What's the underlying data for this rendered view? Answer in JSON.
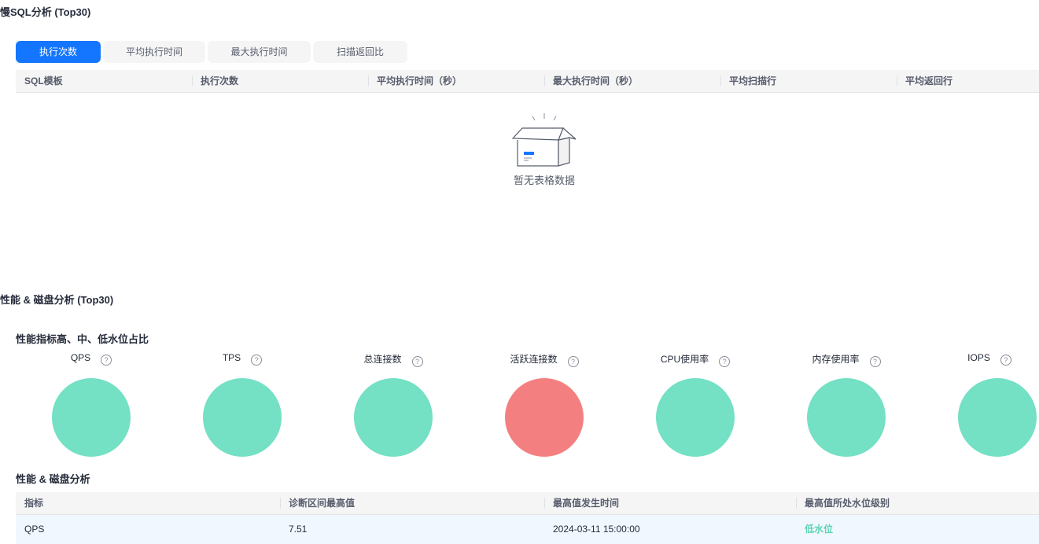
{
  "slow_sql": {
    "title": "慢SQL分析 (Top30)",
    "tabs": [
      {
        "label": "执行次数",
        "active": true
      },
      {
        "label": "平均执行时间",
        "active": false
      },
      {
        "label": "最大执行时间",
        "active": false
      },
      {
        "label": "扫描返回比",
        "active": false
      }
    ],
    "columns": [
      "SQL模板",
      "执行次数",
      "平均执行时间（秒）",
      "最大执行时间（秒）",
      "平均扫描行",
      "平均返回行"
    ],
    "empty_text": "暂无表格数据"
  },
  "performance": {
    "title": "性能 & 磁盘分析 (Top30)",
    "ratio_title": "性能指标高、中、低水位占比",
    "help_glyph": "?",
    "gauges": [
      {
        "label": "QPS",
        "level": "low",
        "color": "#74e0c4"
      },
      {
        "label": "TPS",
        "level": "low",
        "color": "#74e0c4"
      },
      {
        "label": "总连接数",
        "level": "low",
        "color": "#74e0c4"
      },
      {
        "label": "活跃连接数",
        "level": "high",
        "color": "#f47f80"
      },
      {
        "label": "CPU使用率",
        "level": "low",
        "color": "#74e0c4"
      },
      {
        "label": "内存使用率",
        "level": "low",
        "color": "#74e0c4"
      },
      {
        "label": "IOPS",
        "level": "low",
        "color": "#74e0c4"
      }
    ],
    "analysis_title": "性能 & 磁盘分析",
    "analysis_columns": [
      "指标",
      "诊断区间最高值",
      "最高值发生时间",
      "最高值所处水位级别"
    ],
    "analysis_rows": [
      {
        "metric": "QPS",
        "max": "7.51",
        "time": "2024-03-11 15:00:00",
        "level": "低水位"
      }
    ]
  },
  "colors": {
    "primary": "#1476ff",
    "low": "#74e0c4",
    "high": "#f47f80",
    "low_text": "#5cd6b3"
  }
}
